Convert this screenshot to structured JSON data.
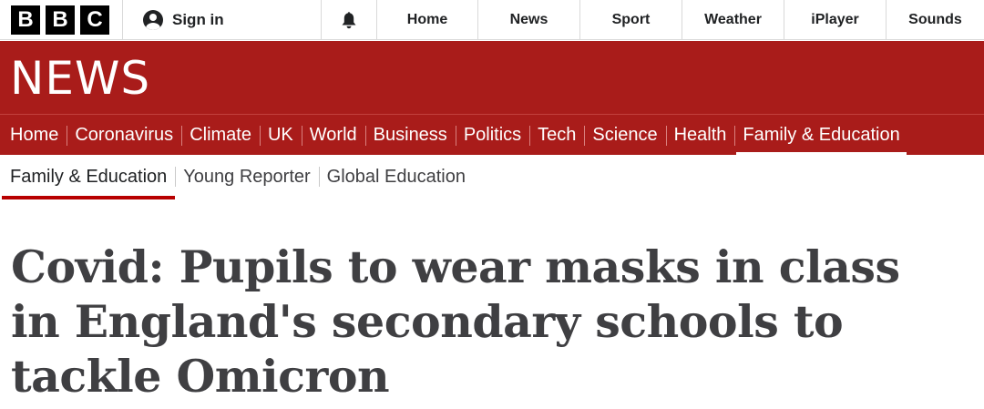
{
  "topbar": {
    "logo_letters": [
      "B",
      "B",
      "C"
    ],
    "signin_label": "Sign in",
    "nav": [
      "Home",
      "News",
      "Sport",
      "Weather",
      "iPlayer",
      "Sounds"
    ]
  },
  "masthead": {
    "title": "NEWS"
  },
  "navbar": {
    "items": [
      "Home",
      "Coronavirus",
      "Climate",
      "UK",
      "World",
      "Business",
      "Politics",
      "Tech",
      "Science",
      "Health",
      "Family & Education"
    ],
    "active": "Family & Education"
  },
  "subnav": {
    "items": [
      "Family & Education",
      "Young Reporter",
      "Global Education"
    ],
    "active": "Family & Education"
  },
  "article": {
    "headline": "Covid: Pupils to wear masks in class in England's secondary schools to tackle Omicron"
  },
  "colors": {
    "brand_red": "#a91c1a",
    "active_underline": "#b80000",
    "text_dark": "#3f3f42"
  },
  "icons": {
    "account": "user-avatar-icon",
    "notifications": "bell-icon"
  }
}
